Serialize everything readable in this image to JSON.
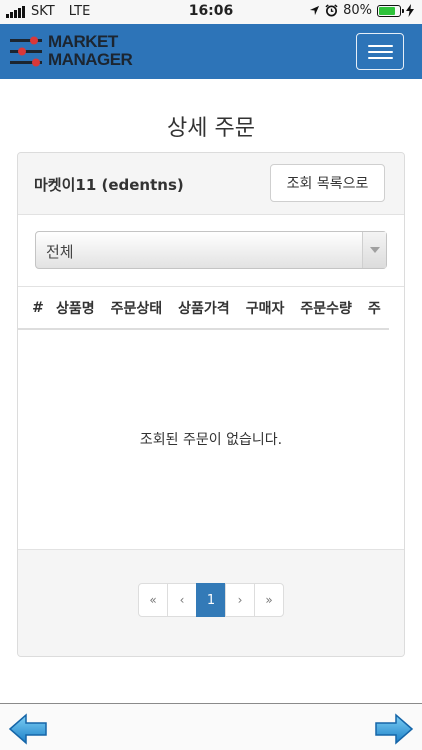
{
  "status_bar": {
    "carrier": "SKT",
    "network": "LTE",
    "time": "16:06",
    "battery": "80%",
    "battery_level": 0.8
  },
  "navbar": {
    "logo_line1": "MARKET",
    "logo_line2": "MANAGER",
    "menu_icon": "hamburger-icon"
  },
  "page": {
    "title": "상세 주문"
  },
  "panel": {
    "market_name": "마켓이11 (edentns)",
    "back_to_list_label": "조회 목록으로",
    "filter": {
      "selected": "전체"
    },
    "table": {
      "columns": [
        "#",
        "상품명",
        "주문상태",
        "상품가격",
        "구매자",
        "주문수량",
        "주"
      ]
    },
    "empty_message": "조회된 주문이 없습니다.",
    "pagination": {
      "first": "«",
      "prev": "‹",
      "current": "1",
      "next": "›",
      "last": "»"
    }
  },
  "colors": {
    "navbar": "#2d74b8",
    "accent": "#337ab7",
    "battery": "#2ec23a"
  }
}
